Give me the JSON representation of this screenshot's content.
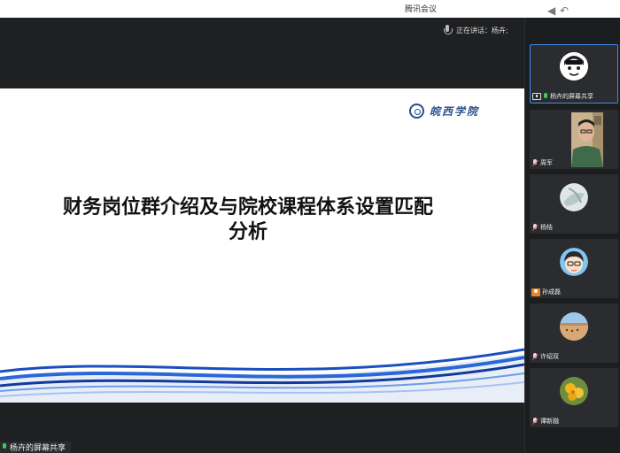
{
  "window": {
    "title": "腾讯会议"
  },
  "speaking": {
    "text": "正在讲话：杨卉;"
  },
  "slide": {
    "logo_text": "皖西学院",
    "title_line1": "财务岗位群介绍及与院校课程体系设置匹配",
    "title_line2": "分析"
  },
  "screen_share_label": "杨卉的屏幕共享",
  "participants": [
    {
      "name": "杨卉的屏幕共享",
      "avatar": "cartoon-avatar",
      "status": "sharing-speaking"
    },
    {
      "name": "周军",
      "avatar": "video-feed",
      "status": "muted"
    },
    {
      "name": "杨桔",
      "avatar": "photo-avatar",
      "status": "muted"
    },
    {
      "name": "孙成磊",
      "avatar": "cartoon-boy-avatar",
      "status": "no-audio"
    },
    {
      "name": "许绍双",
      "avatar": "beach-photo-avatar",
      "status": "muted"
    },
    {
      "name": "谭新融",
      "avatar": "flower-avatar",
      "status": "muted"
    }
  ],
  "colors": {
    "accent": "#3c8cf0",
    "wave_blue": "#1a4fc0",
    "speaking_green": "#3ccf5b",
    "no_audio_orange": "#e8832a"
  }
}
